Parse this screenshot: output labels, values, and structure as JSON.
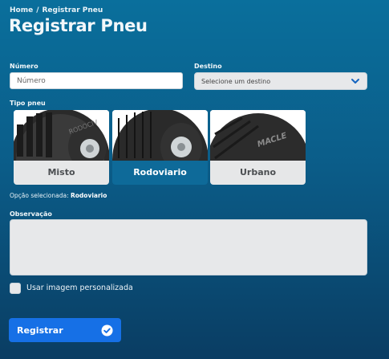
{
  "breadcrumb": {
    "home": "Home",
    "separator": "/",
    "current": "Registrar Pneu"
  },
  "page_title": "Registrar Pneu",
  "form": {
    "numero": {
      "label": "Número",
      "placeholder": "Número",
      "value": ""
    },
    "destino": {
      "label": "Destino",
      "placeholder": "Selecione um destino"
    },
    "tipo_pneu": {
      "label": "Tipo pneu",
      "options": [
        {
          "label": "Misto",
          "selected": false,
          "image_icon": "tire-misto-icon"
        },
        {
          "label": "Rodoviario",
          "selected": true,
          "image_icon": "tire-rodoviario-icon"
        },
        {
          "label": "Urbano",
          "selected": false,
          "image_icon": "tire-urbano-icon"
        }
      ],
      "selected_prefix": "Opção selecionada:",
      "selected_value": "Rodoviario"
    },
    "observacao": {
      "label": "Observação",
      "value": ""
    },
    "custom_image": {
      "label": "Usar imagem personalizada",
      "checked": false
    },
    "submit": {
      "label": "Registrar",
      "icon": "check-circle-icon"
    }
  },
  "colors": {
    "background_top": "#0a6f9c",
    "background_bottom": "#0a3d63",
    "selected_card": "#0e6a99",
    "submit_button": "#1670e6",
    "chevron": "#1565c0"
  }
}
